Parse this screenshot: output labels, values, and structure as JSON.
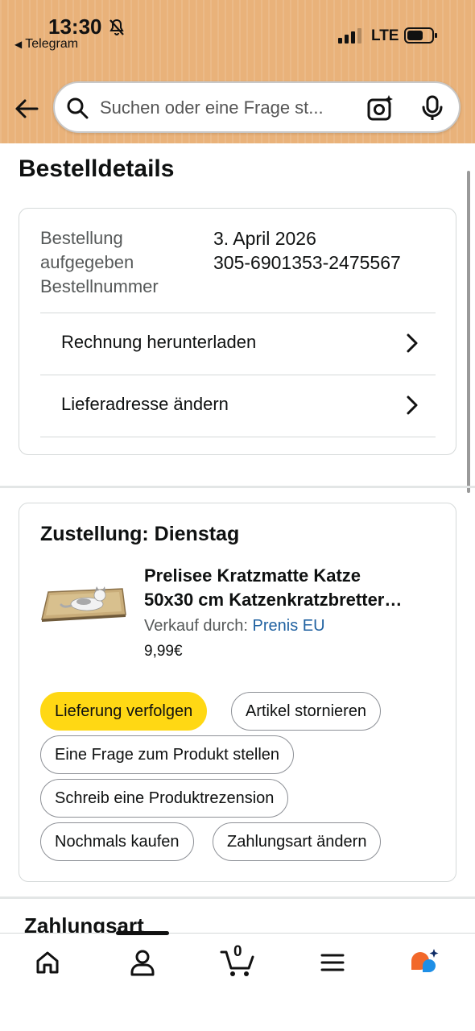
{
  "status_bar": {
    "time": "13:30",
    "back_app": "Telegram",
    "network": "LTE"
  },
  "search": {
    "placeholder": "Suchen oder eine Frage st..."
  },
  "page": {
    "title": "Bestelldetails"
  },
  "order_summary": {
    "labels": [
      "Bestellung",
      "aufgegeben",
      "Bestellnummer"
    ],
    "date": "3. April 2026",
    "order_number": "305-6901353-2475567",
    "links": [
      {
        "label": "Rechnung herunterladen"
      },
      {
        "label": "Lieferadresse ändern"
      }
    ]
  },
  "delivery": {
    "title": "Zustellung: Dienstag",
    "product": {
      "title_line1": "Prelisee Kratzmatte Katze",
      "title_line2": "50x30 cm Katzenkratzbretter…",
      "seller_prefix": "Verkauf durch: ",
      "seller_name": "Prenis EU",
      "price": "9,99€"
    },
    "actions": [
      {
        "label": "Lieferung verfolgen",
        "primary": true
      },
      {
        "label": "Artikel stornieren"
      },
      {
        "label": "Eine Frage zum Produkt stellen"
      },
      {
        "label": "Schreib eine Produktrezension"
      },
      {
        "label": "Nochmals kaufen"
      },
      {
        "label": "Zahlungsart ändern"
      }
    ]
  },
  "next_section": {
    "title": "Zahlungsart"
  },
  "bottom_nav": {
    "cart_count": "0",
    "items": [
      "home-icon",
      "account-icon",
      "cart-icon",
      "menu-icon",
      "rufus-ai-icon"
    ]
  },
  "colors": {
    "header_bg": "#e9b27a",
    "primary_button": "#ffd814",
    "link": "#2162a1",
    "border": "#d5d9d9"
  }
}
